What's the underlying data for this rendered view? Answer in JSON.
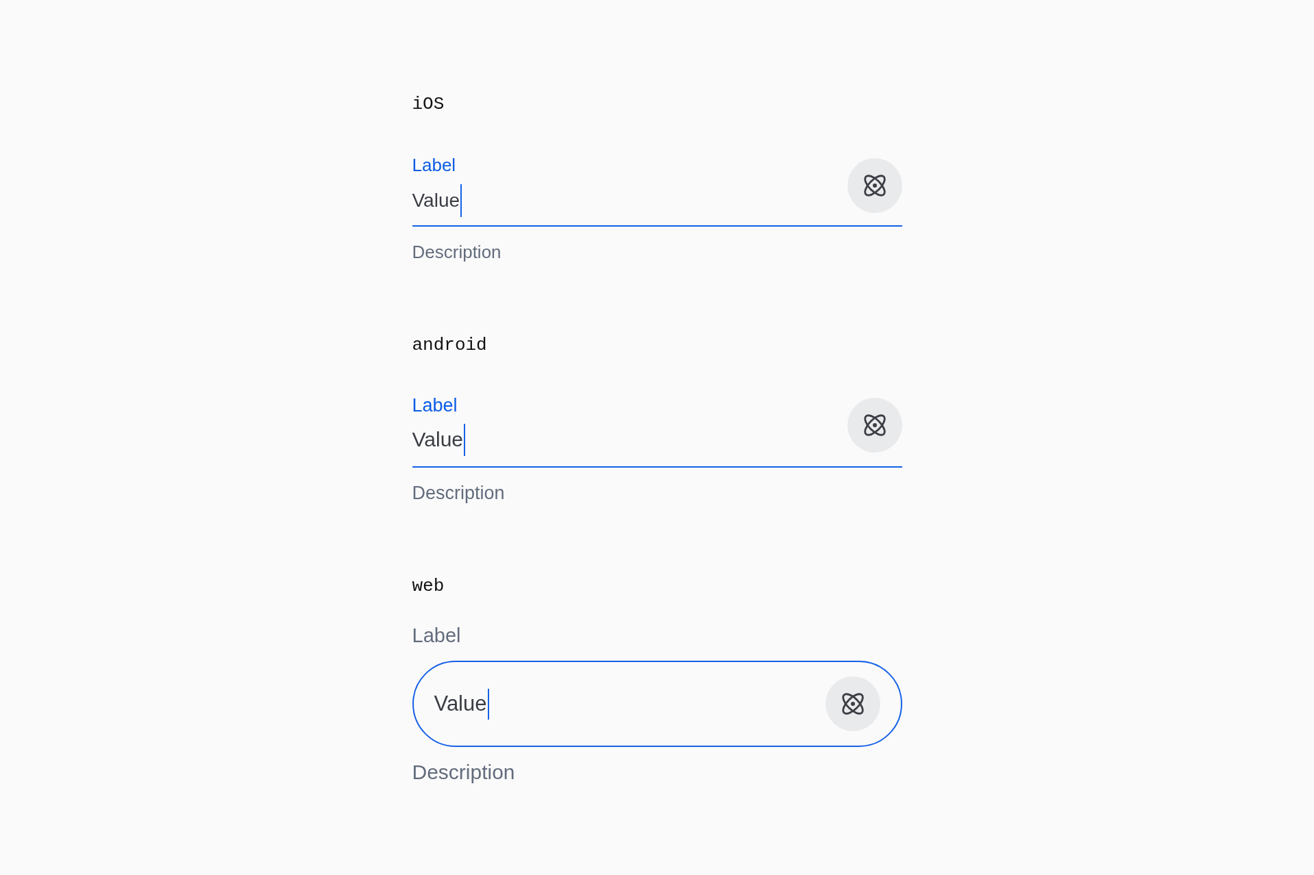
{
  "sections": [
    {
      "heading": "iOS",
      "kind": "ios",
      "field": {
        "label": "Label",
        "value": "Value",
        "description": "Description",
        "focused": true
      }
    },
    {
      "heading": "android",
      "kind": "android",
      "field": {
        "label": "Label",
        "value": "Value",
        "description": "Description",
        "focused": true
      }
    },
    {
      "heading": "web",
      "kind": "web",
      "field": {
        "label": "Label",
        "value": "Value",
        "description": "Description",
        "focused": true
      }
    }
  ]
}
